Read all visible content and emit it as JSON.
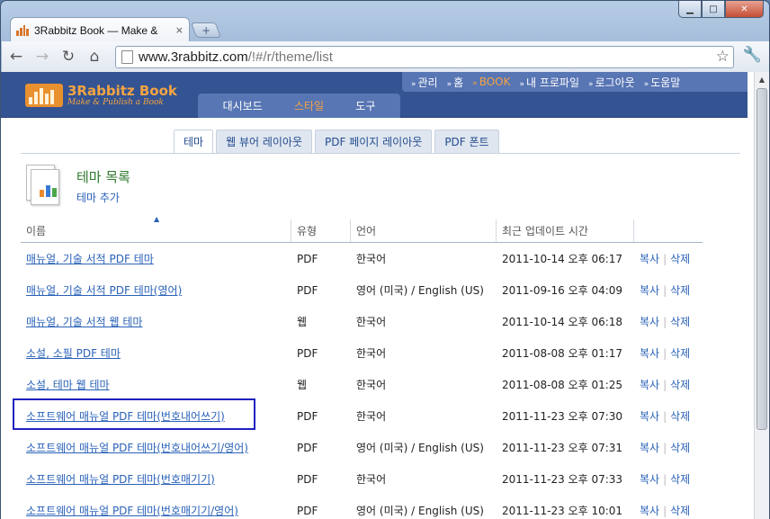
{
  "browser": {
    "tab_title": "3Rabbitz Book — Make &",
    "tab_close": "×",
    "newtab": "+",
    "url_host": "www.3rabbitz.com",
    "url_path": "/!#/r/theme/list",
    "window_controls": {
      "minimize": "▁",
      "maximize": "□",
      "close": "✕"
    },
    "icons": {
      "back": "arrow-left-icon",
      "forward": "arrow-right-icon",
      "reload": "reload-icon",
      "home": "home-icon",
      "star": "star-icon",
      "wrench": "wrench-icon"
    }
  },
  "site": {
    "logo_title": "3Rabbitz Book",
    "logo_subtitle": "Make & Publish a Book",
    "topnav": [
      "관리",
      "홈",
      "BOOK",
      "내 프로파일",
      "로그아웃",
      "도움말"
    ],
    "topnav_active_index": 2,
    "mainnav": [
      "대시보드",
      "스타일",
      "도구"
    ],
    "mainnav_active_index": 1,
    "subtabs": [
      "테마",
      "웹 뷰어 레이아웃",
      "PDF 페이지 레이아웃",
      "PDF 폰트"
    ],
    "subtabs_active_index": 0,
    "accent_color": "#f3a443",
    "header_color": "#345392"
  },
  "page": {
    "title": "테마 목록",
    "add_link": "테마 추가"
  },
  "table": {
    "columns": [
      "이름",
      "유형",
      "언어",
      "최근 업데이트 시간",
      ""
    ],
    "action_copy": "복사",
    "action_delete": "삭제",
    "action_sep": "|",
    "rows": [
      {
        "name": "매뉴얼, 기술 서적 PDF 테마",
        "type": "PDF",
        "lang": "한국어",
        "updated": "2011-10-14 오후 06:17"
      },
      {
        "name": "매뉴얼, 기술 서적 PDF 테마(영어)",
        "type": "PDF",
        "lang": "영어 (미국) / English (US)",
        "updated": "2011-09-16 오후 04:09"
      },
      {
        "name": "매뉴얼, 기술 서적 웹 테마",
        "type": "웹",
        "lang": "한국어",
        "updated": "2011-10-14 오후 06:18"
      },
      {
        "name": "소설, 소필 PDF 테마",
        "type": "PDF",
        "lang": "한국어",
        "updated": "2011-08-08 오후 01:17"
      },
      {
        "name": "소설, 테마 웹 테마",
        "type": "웹",
        "lang": "한국어",
        "updated": "2011-08-08 오후 01:25"
      },
      {
        "name": "소프트웨어 매뉴얼 PDF 테마(번호내어쓰기)",
        "type": "PDF",
        "lang": "한국어",
        "updated": "2011-11-23 오후 07:30"
      },
      {
        "name": "소프트웨어 매뉴얼 PDF 테마(번호내어쓰기/영어)",
        "type": "PDF",
        "lang": "영어 (미국) / English (US)",
        "updated": "2011-11-23 오후 07:31"
      },
      {
        "name": "소프트웨어 매뉴얼 PDF 테마(번호매기기)",
        "type": "PDF",
        "lang": "한국어",
        "updated": "2011-11-23 오후 07:33"
      },
      {
        "name": "소프트웨어 매뉴얼 PDF 테마(번호매기기/영어)",
        "type": "PDF",
        "lang": "영어 (미국) / English (US)",
        "updated": "2011-11-23 오후 10:01"
      }
    ]
  }
}
